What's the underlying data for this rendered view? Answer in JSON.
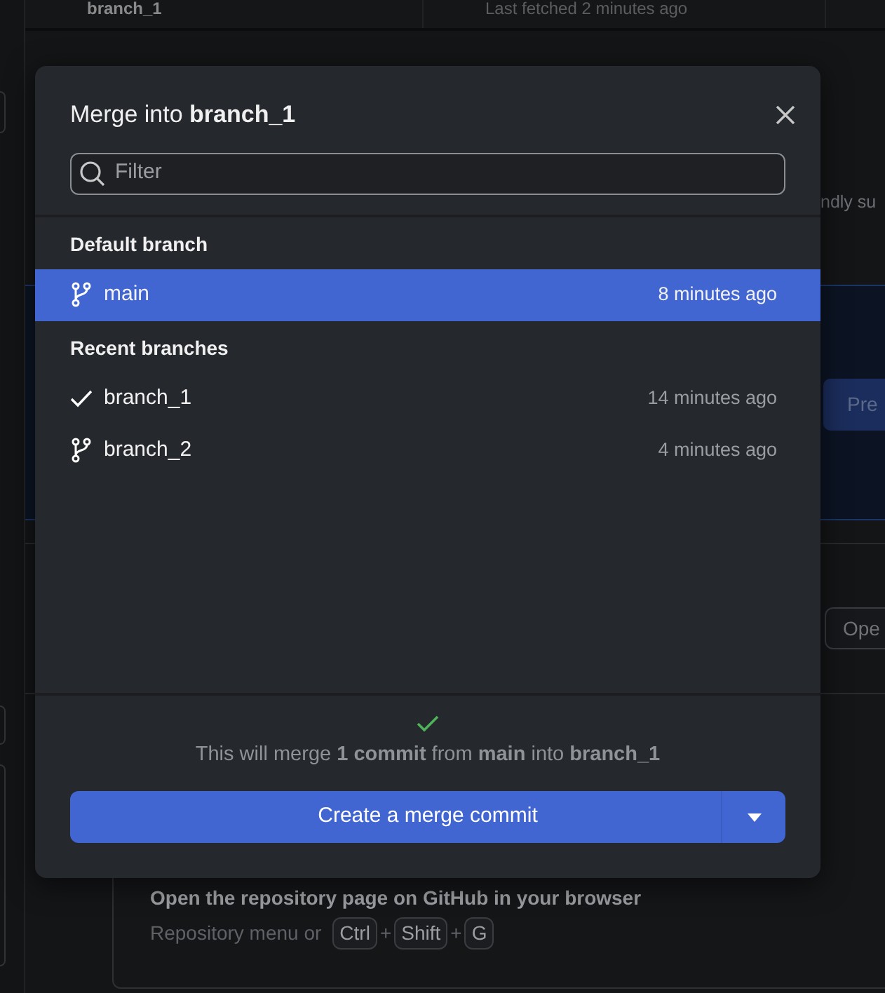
{
  "background": {
    "top_bar": {
      "branch": "branch_1",
      "fetch_status": "Last fetched 2 minutes ago"
    },
    "side_text": "ndly su",
    "preview_button": "Pre",
    "open_button": "Ope",
    "tip": {
      "title": "Open the repository page on GitHub in your browser",
      "text": "Repository menu or",
      "keys": [
        "Ctrl",
        "Shift",
        "G"
      ],
      "separators": [
        "+",
        "+"
      ]
    }
  },
  "dialog": {
    "title": "Merge into **branch_1**",
    "filter": {
      "placeholder": "Filter"
    },
    "groups": [
      {
        "heading": "Default branch",
        "branches": [
          {
            "name": "main",
            "time": "8 minutes ago",
            "selected": true,
            "current": false
          }
        ]
      },
      {
        "heading": "Recent branches",
        "branches": [
          {
            "name": "branch_1",
            "time": "14 minutes ago",
            "selected": false,
            "current": true
          },
          {
            "name": "branch_2",
            "time": "4 minutes ago",
            "selected": false,
            "current": false
          }
        ]
      }
    ],
    "summary": "This will merge **1 commit** from **main** into **branch_1**",
    "merge_button": "Create a merge commit"
  }
}
